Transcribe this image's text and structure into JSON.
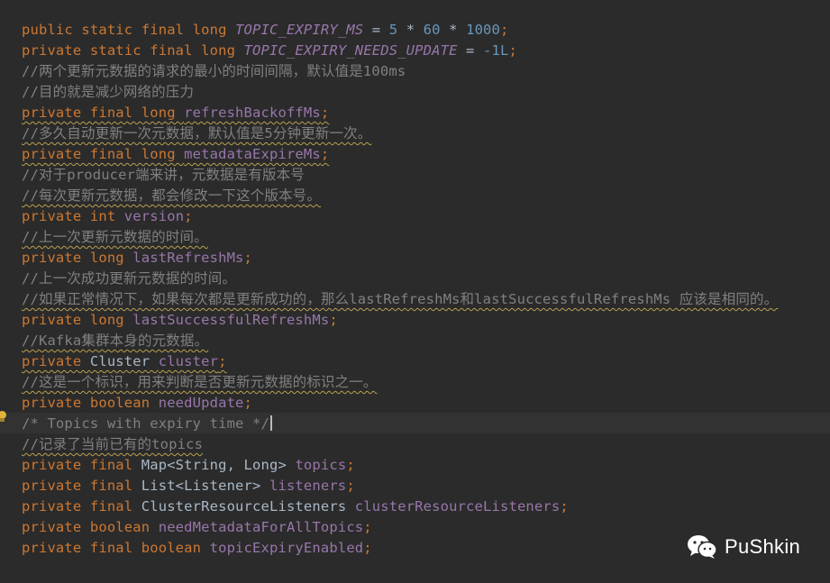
{
  "editor": {
    "lines": [
      {
        "parts": [
          {
            "t": "public static final long ",
            "c": "kw"
          },
          {
            "t": "TOPIC_EXPIRY_MS",
            "c": "const"
          },
          {
            "t": " = ",
            "c": "plain"
          },
          {
            "t": "5",
            "c": "num"
          },
          {
            "t": " * ",
            "c": "plain"
          },
          {
            "t": "60",
            "c": "num"
          },
          {
            "t": " * ",
            "c": "plain"
          },
          {
            "t": "1000",
            "c": "num"
          },
          {
            "t": ";",
            "c": "kw"
          }
        ]
      },
      {
        "parts": [
          {
            "t": "private static final long ",
            "c": "kw"
          },
          {
            "t": "TOPIC_EXPIRY_NEEDS_UPDATE",
            "c": "const"
          },
          {
            "t": " = ",
            "c": "plain"
          },
          {
            "t": "-1L",
            "c": "num"
          },
          {
            "t": ";",
            "c": "kw"
          }
        ]
      },
      {
        "parts": [
          {
            "t": "//两个更新元数据的请求的最小的时间间隔，默认值是100ms",
            "c": "cmt"
          }
        ]
      },
      {
        "parts": [
          {
            "t": "//目的就是减少网络的压力",
            "c": "cmt"
          }
        ]
      },
      {
        "wavy": true,
        "parts": [
          {
            "t": "private final long ",
            "c": "kw"
          },
          {
            "t": "refreshBackoffMs",
            "c": "field"
          },
          {
            "t": ";",
            "c": "kw"
          }
        ]
      },
      {
        "wavy": true,
        "parts": [
          {
            "t": "//多久自动更新一次元数据，默认值是5分钟更新一次。",
            "c": "cmt"
          }
        ]
      },
      {
        "wavy": true,
        "parts": [
          {
            "t": "private final long ",
            "c": "kw"
          },
          {
            "t": "metadataExpireMs",
            "c": "field"
          },
          {
            "t": ";",
            "c": "kw"
          }
        ]
      },
      {
        "parts": [
          {
            "t": "//对于producer端来讲，元数据是有版本号",
            "c": "cmt"
          }
        ]
      },
      {
        "wavy": true,
        "parts": [
          {
            "t": "//每次更新元数据，都会修改一下这个版本号。",
            "c": "cmt"
          }
        ]
      },
      {
        "parts": [
          {
            "t": "private int ",
            "c": "kw"
          },
          {
            "t": "version",
            "c": "field"
          },
          {
            "t": ";",
            "c": "kw"
          }
        ]
      },
      {
        "wavy": true,
        "parts": [
          {
            "t": "//上一次更新元数据的时间。",
            "c": "cmt"
          }
        ]
      },
      {
        "parts": [
          {
            "t": "private long ",
            "c": "kw"
          },
          {
            "t": "lastRefreshMs",
            "c": "field"
          },
          {
            "t": ";",
            "c": "kw"
          }
        ]
      },
      {
        "parts": [
          {
            "t": "//上一次成功更新元数据的时间。",
            "c": "cmt"
          }
        ]
      },
      {
        "wavy": true,
        "parts": [
          {
            "t": "//如果正常情况下，如果每次都是更新成功的，那么lastRefreshMs和lastSuccessfulRefreshMs 应该是相同的。",
            "c": "cmt"
          }
        ]
      },
      {
        "parts": [
          {
            "t": "private long ",
            "c": "kw"
          },
          {
            "t": "lastSuccessfulRefreshMs",
            "c": "field"
          },
          {
            "t": ";",
            "c": "kw"
          }
        ]
      },
      {
        "wavy": true,
        "parts": [
          {
            "t": "//Kafka集群本身的元数据。",
            "c": "cmt"
          }
        ]
      },
      {
        "wavy": true,
        "parts": [
          {
            "t": "private ",
            "c": "kw"
          },
          {
            "t": "Cluster ",
            "c": "plain"
          },
          {
            "t": "cluster",
            "c": "field"
          },
          {
            "t": ";",
            "c": "kw"
          }
        ]
      },
      {
        "wavy": true,
        "parts": [
          {
            "t": "//这是一个标识，用来判断是否更新元数据的标识之一。",
            "c": "cmt"
          }
        ]
      },
      {
        "parts": [
          {
            "t": "private boolean ",
            "c": "kw"
          },
          {
            "t": "needUpdate",
            "c": "field"
          },
          {
            "t": ";",
            "c": "kw"
          }
        ]
      },
      {
        "current": true,
        "parts": [
          {
            "t": "/* Topics with expiry time */",
            "c": "cmt"
          }
        ]
      },
      {
        "wavy": true,
        "parts": [
          {
            "t": "//记录了当前已有的topics",
            "c": "cmt"
          }
        ]
      },
      {
        "parts": [
          {
            "t": "private final ",
            "c": "kw"
          },
          {
            "t": "Map<String, Long> ",
            "c": "plain"
          },
          {
            "t": "topics",
            "c": "field"
          },
          {
            "t": ";",
            "c": "kw"
          }
        ]
      },
      {
        "parts": [
          {
            "t": "private final ",
            "c": "kw"
          },
          {
            "t": "List<Listener> ",
            "c": "plain"
          },
          {
            "t": "listeners",
            "c": "field"
          },
          {
            "t": ";",
            "c": "kw"
          }
        ]
      },
      {
        "parts": [
          {
            "t": "private final ",
            "c": "kw"
          },
          {
            "t": "ClusterResourceListeners ",
            "c": "plain"
          },
          {
            "t": "clusterResourceListeners",
            "c": "field"
          },
          {
            "t": ";",
            "c": "kw"
          }
        ]
      },
      {
        "parts": [
          {
            "t": "private boolean ",
            "c": "kw"
          },
          {
            "t": "needMetadataForAllTopics",
            "c": "field"
          },
          {
            "t": ";",
            "c": "kw"
          }
        ]
      },
      {
        "parts": [
          {
            "t": "private final boolean ",
            "c": "kw"
          },
          {
            "t": "topicExpiryEnabled",
            "c": "field"
          },
          {
            "t": ";",
            "c": "kw"
          }
        ]
      }
    ]
  },
  "intention_icon": "lightbulb-icon",
  "watermark": {
    "icon": "wechat-icon",
    "text": "PuShkin"
  },
  "colors": {
    "background": "#2b2b2b",
    "keyword": "#cc7832",
    "field": "#9876aa",
    "number": "#6897bb",
    "comment": "#808080",
    "plain": "#a9b7c6"
  }
}
